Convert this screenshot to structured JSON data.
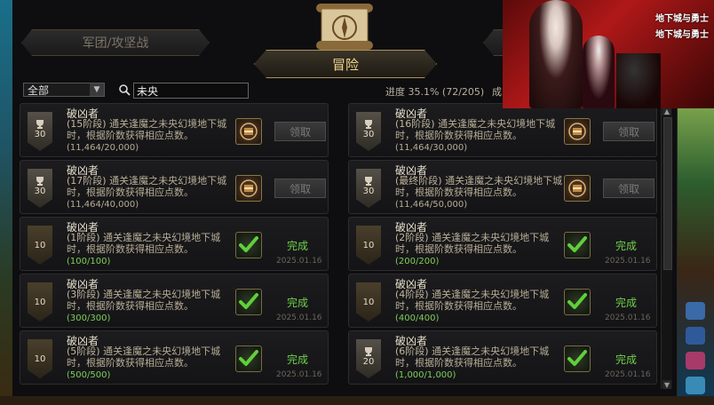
{
  "tabs": {
    "left_label": "军团/攻坚战",
    "center_label": "冒险"
  },
  "filter": {
    "category_selected": "全部",
    "search_value": "未央",
    "progress_text": "进度 35.1% (72/205)",
    "progress_extra": "成"
  },
  "achievements": [
    {
      "title": "破凶者",
      "stage": "(15阶段)",
      "desc": "通关逢魔之未央幻境地下城时，根据阶数获得相应点数。",
      "count": "(11,464/20,000)",
      "points": "30",
      "badge": "trophy",
      "status": "claim",
      "button": "领取"
    },
    {
      "title": "破凶者",
      "stage": "(16阶段)",
      "desc": "通关逢魔之未央幻境地下城时，根据阶数获得相应点数。",
      "count": "(11,464/30,000)",
      "points": "30",
      "badge": "trophy",
      "status": "claim",
      "button": "领取"
    },
    {
      "title": "破凶者",
      "stage": "(17阶段)",
      "desc": "通关逢魔之未央幻境地下城时，根据阶数获得相应点数。",
      "count": "(11,464/40,000)",
      "points": "30",
      "badge": "trophy",
      "status": "claim",
      "button": "领取"
    },
    {
      "title": "破凶者",
      "stage": "(最终阶段)",
      "desc": "通关逢魔之未央幻境地下城时，根据阶数获得相应点数。",
      "count": "(11,464/50,000)",
      "points": "30",
      "badge": "trophy",
      "status": "claim",
      "button": "领取"
    },
    {
      "title": "破凶者",
      "stage": "(1阶段)",
      "desc": "通关逢魔之未央幻境地下城时，根据阶数获得相应点数。",
      "count": "(100/100)",
      "points": "10",
      "badge": "plain",
      "status": "done",
      "done_label": "完成",
      "date": "2025.01.16"
    },
    {
      "title": "破凶者",
      "stage": "(2阶段)",
      "desc": "通关逢魔之未央幻境地下城时，根据阶数获得相应点数。",
      "count": "(200/200)",
      "points": "10",
      "badge": "plain",
      "status": "done",
      "done_label": "完成",
      "date": "2025.01.16"
    },
    {
      "title": "破凶者",
      "stage": "(3阶段)",
      "desc": "通关逢魔之未央幻境地下城时，根据阶数获得相应点数。",
      "count": "(300/300)",
      "points": "10",
      "badge": "plain",
      "status": "done",
      "done_label": "完成",
      "date": "2025.01.16"
    },
    {
      "title": "破凶者",
      "stage": "(4阶段)",
      "desc": "通关逢魔之未央幻境地下城时，根据阶数获得相应点数。",
      "count": "(400/400)",
      "points": "10",
      "badge": "plain",
      "status": "done",
      "done_label": "完成",
      "date": "2025.01.16"
    },
    {
      "title": "破凶者",
      "stage": "(5阶段)",
      "desc": "通关逢魔之未央幻境地下城时，根据阶数获得相应点数。",
      "count": "(500/500)",
      "points": "10",
      "badge": "plain",
      "status": "done",
      "done_label": "完成",
      "date": "2025.01.16"
    },
    {
      "title": "破凶者",
      "stage": "(6阶段)",
      "desc": "通关逢魔之未央幻境地下城时，根据阶数获得相应点数。",
      "count": "(1,000/1,000)",
      "points": "20",
      "badge": "trophy",
      "status": "done",
      "done_label": "完成",
      "date": "2025.01.16"
    }
  ],
  "ad": {
    "logo_line1": "地下城与勇士",
    "logo_line2": "地下城与勇士"
  },
  "colors": {
    "accent_gold": "#f0d58a",
    "done_green": "#6fd04a",
    "count_green": "#7fcf5a"
  },
  "icons": {
    "search": "search-icon",
    "trophy": "trophy-icon",
    "reward": "reward-chest-icon",
    "check": "checkmark-icon",
    "compass": "compass-scroll-icon"
  }
}
